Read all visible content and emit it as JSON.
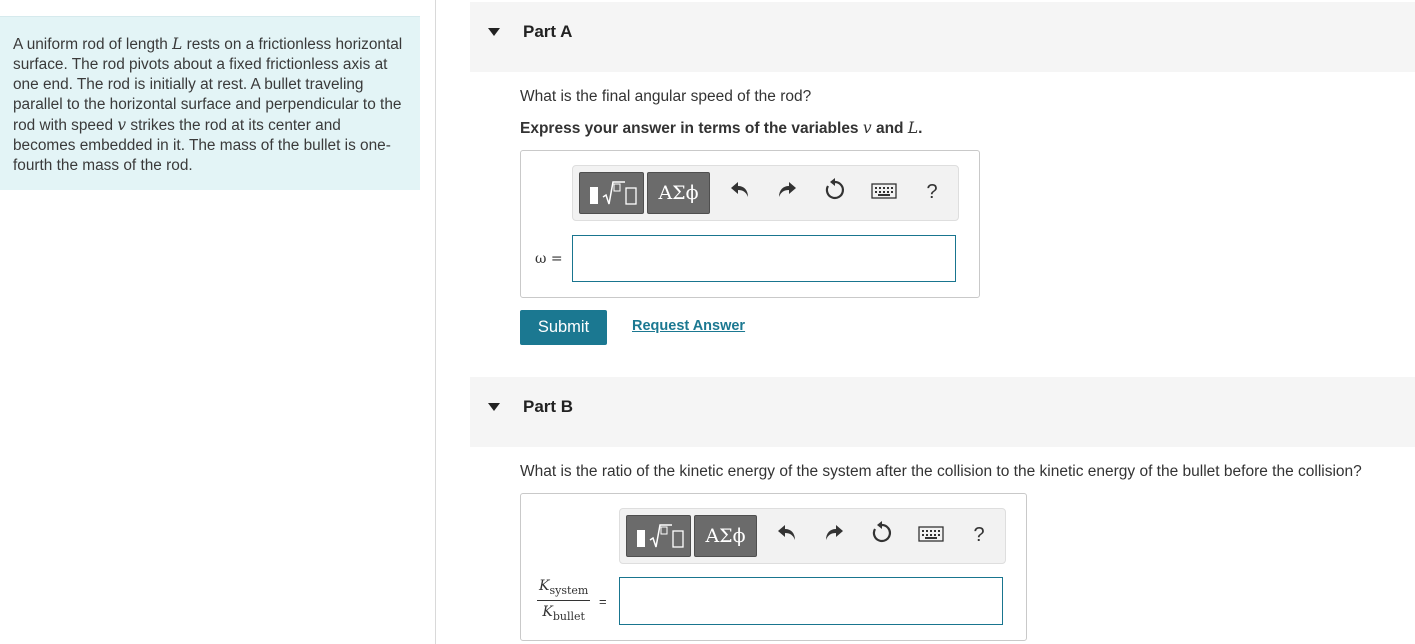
{
  "problem": {
    "text_1": "A uniform rod of length ",
    "var_L": "L",
    "text_2": " rests on a frictionless horizontal surface. The rod pivots about a fixed frictionless axis at one end. The rod is initially at rest. A bullet traveling parallel to the horizontal surface and perpendicular to the rod with speed ",
    "var_v": "v",
    "text_3": " strikes the rod at its center and becomes embedded in it. The mass of the bullet is one-fourth the mass of the rod."
  },
  "part_a": {
    "title": "Part A",
    "question": "What is the final angular speed of the rod?",
    "instruction_prefix": "Express your answer in terms of the variables ",
    "instruction_var1": "v",
    "instruction_and": " and ",
    "instruction_var2": "L",
    "instruction_suffix": ".",
    "answer_label": "ω =",
    "answer_value": "",
    "submit_label": "Submit",
    "request_label": "Request Answer"
  },
  "part_b": {
    "title": "Part B",
    "question": "What is the ratio of the kinetic energy of the system after the collision to the kinetic energy of the bullet before the collision?",
    "frac_num_var": "K",
    "frac_num_sub": "system",
    "frac_den_var": "K",
    "frac_den_sub": "bullet",
    "eq_sign": "=",
    "answer_value": ""
  },
  "toolbar": {
    "greek_label": "ΑΣϕ",
    "help_label": "?",
    "icons": [
      "templates-icon",
      "greek-symbols-icon",
      "undo-icon",
      "redo-icon",
      "reset-icon",
      "keyboard-icon",
      "help-icon"
    ]
  },
  "colors": {
    "accent": "#1b7891",
    "problem_bg": "#e3f4f6",
    "header_bg": "#f5f5f5",
    "toolbar_btn": "#6b6b6b"
  }
}
